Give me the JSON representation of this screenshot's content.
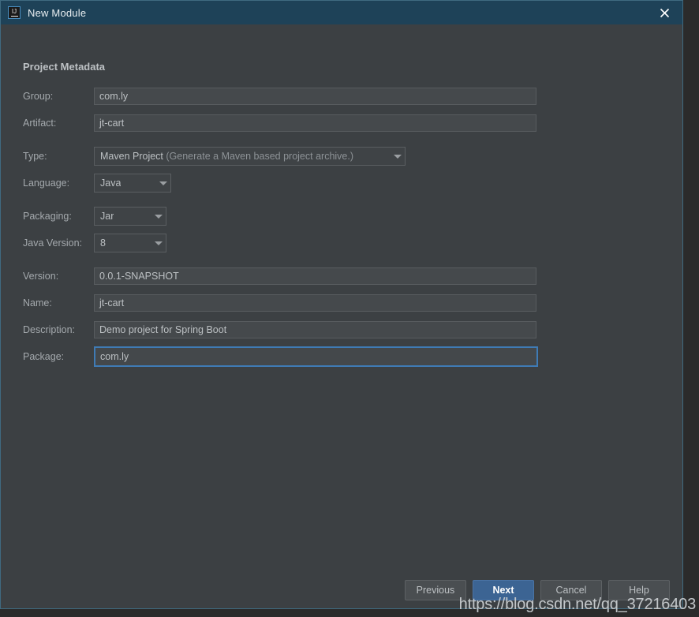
{
  "window": {
    "title": "New Module",
    "app_icon": "intellij-idea-icon",
    "close_icon": "close-icon",
    "titlebar_color": "#1e4258",
    "body_color": "#3c4043",
    "accent_color": "#3f7bb5",
    "border_color": "#3f6a80"
  },
  "form": {
    "section_title": "Project Metadata",
    "fields": [
      {
        "label": "Group:",
        "value": "com.ly",
        "kind": "text"
      },
      {
        "label": "Artifact:",
        "value": "jt-cart",
        "kind": "text"
      },
      {
        "label": "Type:",
        "value": "Maven Project",
        "value_note": "(Generate a Maven based project archive.)",
        "kind": "combo"
      },
      {
        "label": "Language:",
        "value": "Java",
        "kind": "combo"
      },
      {
        "label": "Packaging:",
        "value": "Jar",
        "kind": "combo"
      },
      {
        "label": "Java Version:",
        "value": "8",
        "kind": "combo"
      },
      {
        "label": "Version:",
        "value": "0.0.1-SNAPSHOT",
        "kind": "text"
      },
      {
        "label": "Name:",
        "value": "jt-cart",
        "kind": "text"
      },
      {
        "label": "Description:",
        "value": "Demo project for Spring Boot",
        "kind": "text"
      },
      {
        "label": "Package:",
        "value": "com.ly",
        "kind": "text",
        "focused": true
      }
    ]
  },
  "buttons": {
    "previous": "Previous",
    "next": "Next",
    "cancel": "Cancel",
    "help": "Help"
  },
  "watermark": "https://blog.csdn.net/qq_37216403"
}
